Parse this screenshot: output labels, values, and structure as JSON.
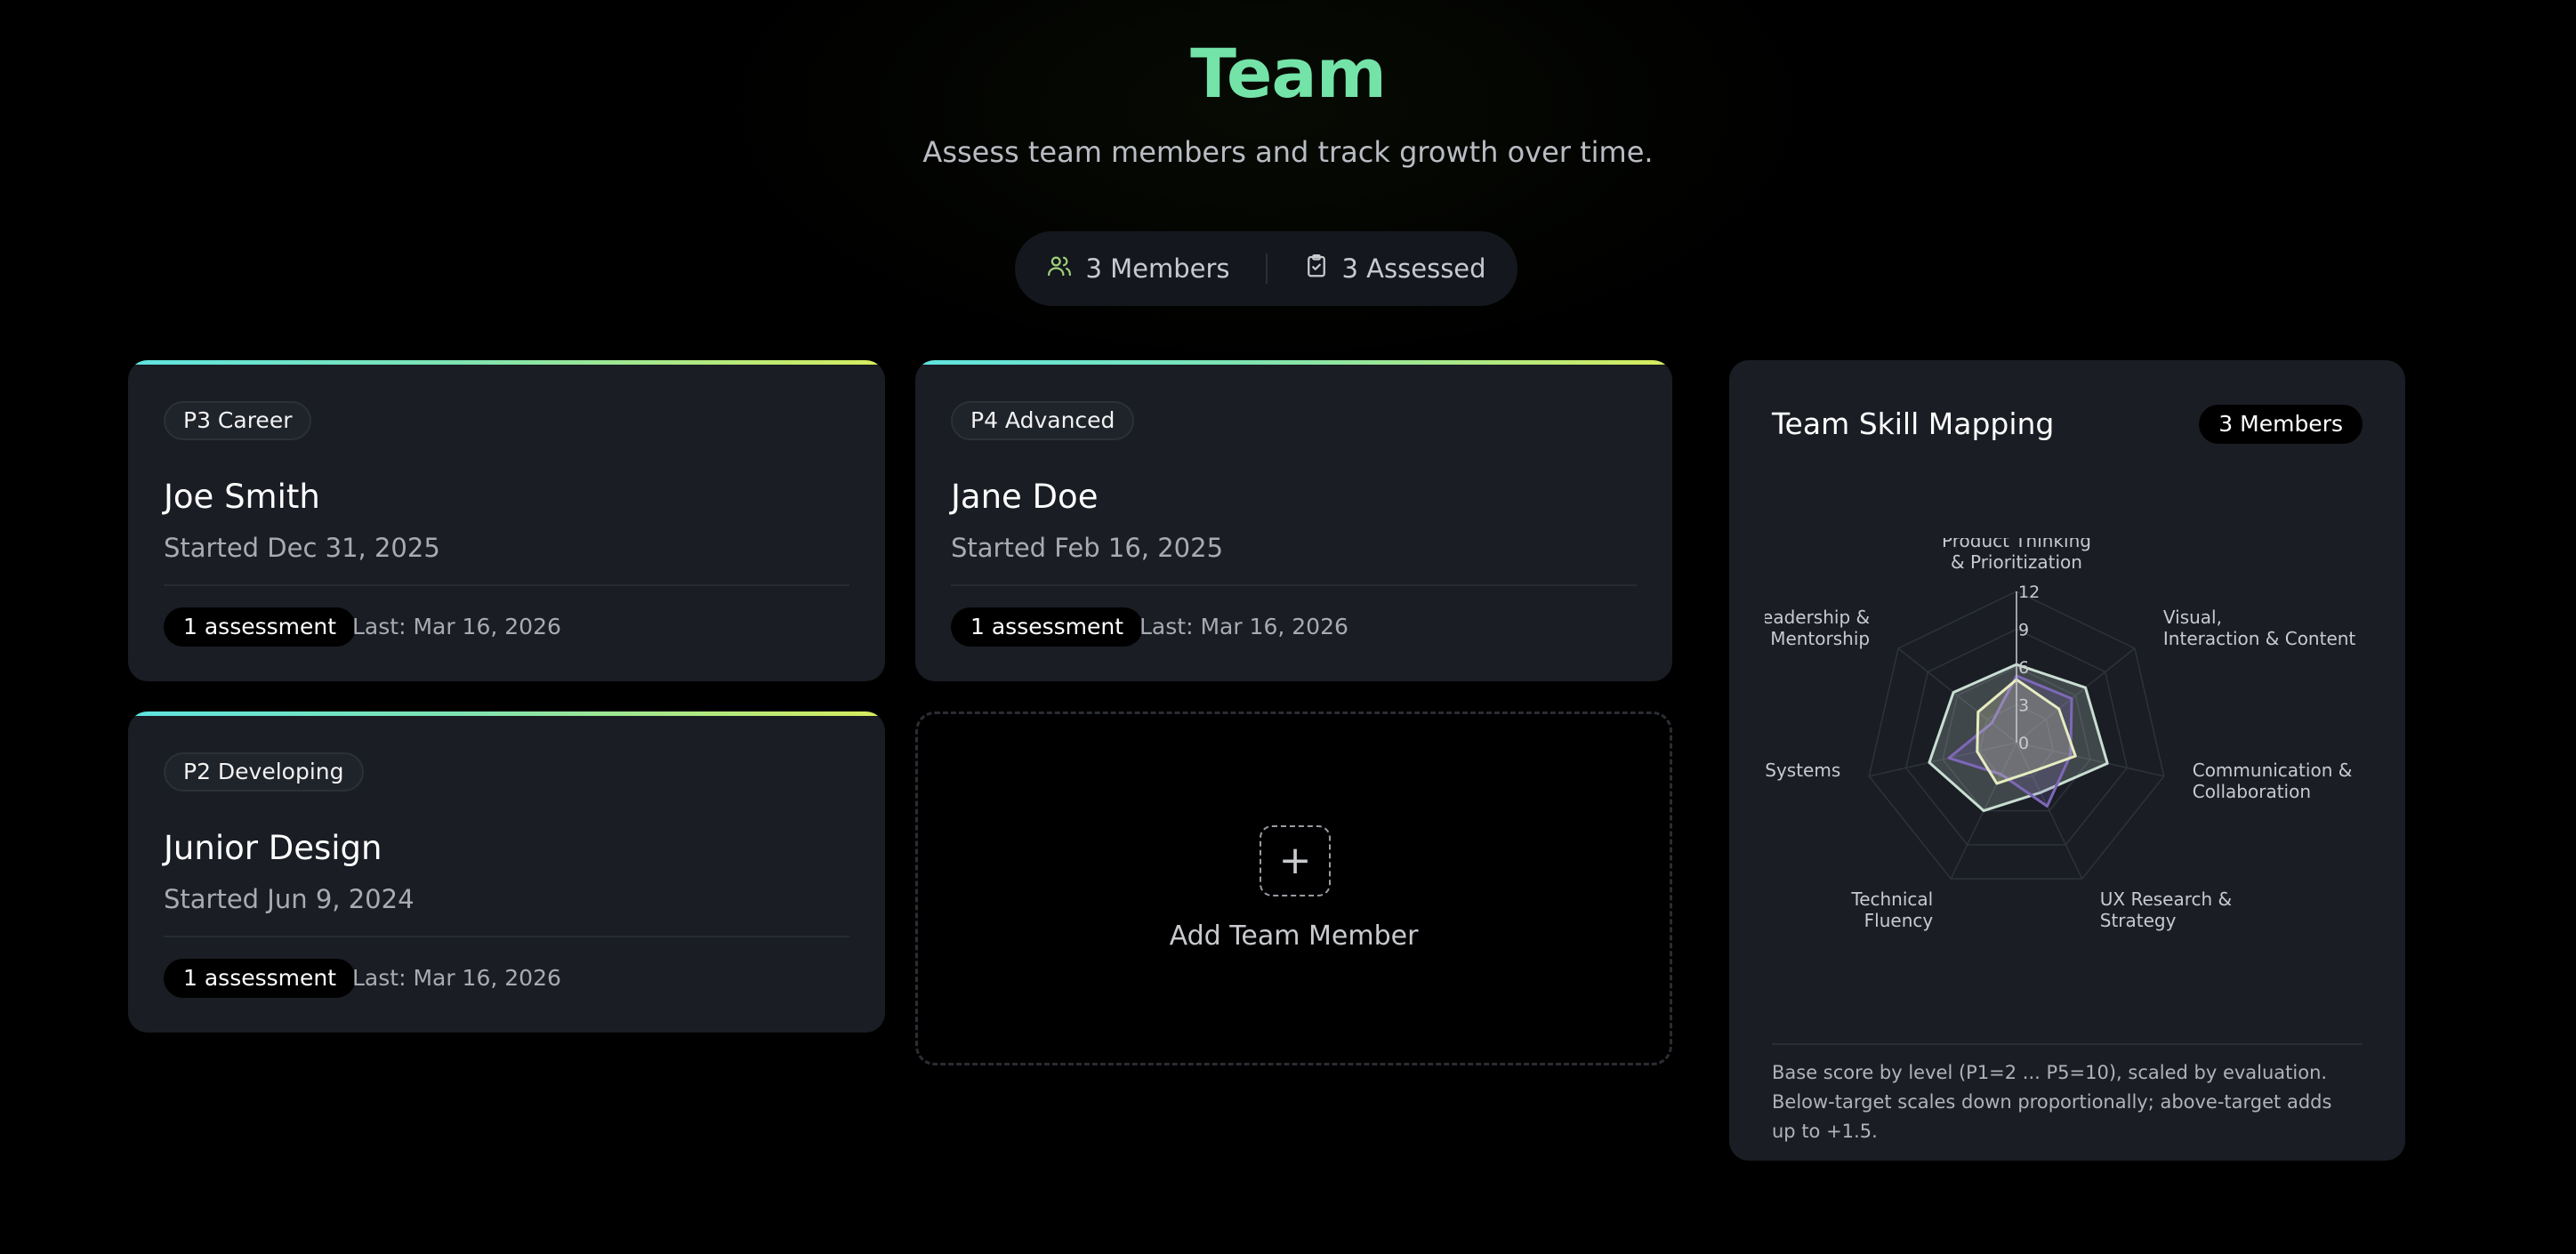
{
  "header": {
    "title": "Team",
    "subtitle": "Assess team members and track growth over time."
  },
  "stats": {
    "members_label": "3 Members",
    "assessed_label": "3 Assessed",
    "members_icon": "users-icon",
    "assessed_icon": "clipboard-check-icon"
  },
  "members": [
    {
      "level": "P3 Career",
      "name": "Joe Smith",
      "started": "Started Dec 31, 2025",
      "assessments": "1 assessment",
      "last": "Last: Mar 16, 2026"
    },
    {
      "level": "P4 Advanced",
      "name": "Jane Doe",
      "started": "Started Feb 16, 2025",
      "assessments": "1 assessment",
      "last": "Last: Mar 16, 2026"
    },
    {
      "level": "P2 Developing",
      "name": "Junior Design",
      "started": "Started Jun 9, 2024",
      "assessments": "1 assessment",
      "last": "Last: Mar 16, 2026"
    }
  ],
  "add_member": {
    "label": "Add Team Member",
    "icon": "plus-icon"
  },
  "skill_panel": {
    "title": "Team Skill Mapping",
    "badge": "3 Members",
    "footnote": "Base score by level (P1=2 ... P5=10), scaled by evaluation. Below-target scales down proportionally; above-target adds up to +1.5."
  },
  "chart_data": {
    "type": "radar",
    "axes": [
      [
        "Product Thinking",
        "& Prioritization"
      ],
      [
        "Visual,",
        "Interaction & Content"
      ],
      [
        "Communication &",
        "Collaboration"
      ],
      [
        "UX Research &",
        "Strategy"
      ],
      [
        "Technical",
        "Fluency"
      ],
      [
        "Design Systems"
      ],
      [
        "Leadership &",
        "Mentorship"
      ]
    ],
    "ticks": [
      "0",
      "3",
      "6",
      "9",
      "12"
    ],
    "rmax": 12,
    "series": [
      {
        "values": [
          6.2,
          7.0,
          7.4,
          4.4,
          6.0,
          7.1,
          6.4
        ],
        "color": "#c8ded2"
      },
      {
        "values": [
          5.3,
          5.6,
          4.4,
          5.6,
          2.8,
          5.5,
          2.5
        ],
        "color": "#7d68b8"
      },
      {
        "values": [
          5.0,
          4.3,
          4.8,
          2.6,
          3.6,
          3.2,
          3.9
        ],
        "color": "#e6ecc0"
      }
    ]
  },
  "colors": {
    "accent": "#74e3a8",
    "card_bg": "#1a1d24",
    "gradient_start": "#5fe3e0",
    "gradient_end": "#d7ec5c"
  }
}
